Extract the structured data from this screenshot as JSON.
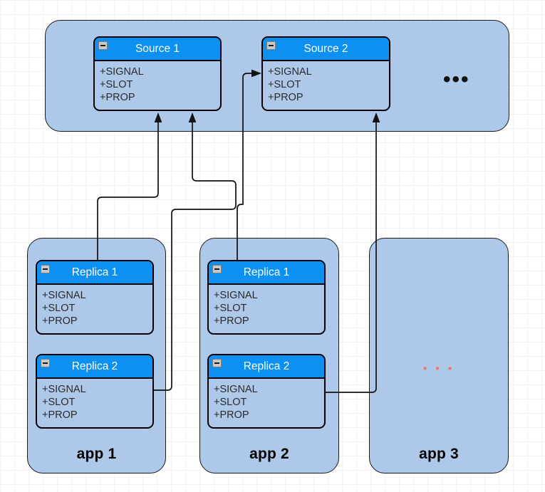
{
  "diagram": {
    "title": "Signal/Slot source and replica object diagram",
    "colors": {
      "group_fill": "#aec8ea",
      "node_title_bar": "#0c90f2",
      "node_title_text": "#ffffff",
      "node_body_fill": "#aec8ea",
      "node_border": "#000000",
      "connector": "#111111",
      "ellipsis_accent": "#f3705a",
      "grid_minor": "#f2f2f2",
      "grid_major": "#dadada",
      "canvas_background": "#ffffff"
    }
  },
  "members": [
    "+SIGNAL",
    "+SLOT",
    "+PROP"
  ],
  "icons": {
    "collapse": "collapse-minus-icon"
  },
  "source_group": {
    "name": "source-container",
    "ellipsis": "•••",
    "nodes": [
      {
        "title": "Source 1",
        "members": [
          "+SIGNAL",
          "+SLOT",
          "+PROP"
        ]
      },
      {
        "title": "Source 2",
        "members": [
          "+SIGNAL",
          "+SLOT",
          "+PROP"
        ]
      }
    ]
  },
  "apps": [
    {
      "label": "app 1",
      "nodes": [
        {
          "title": "Replica 1",
          "members": [
            "+SIGNAL",
            "+SLOT",
            "+PROP"
          ]
        },
        {
          "title": "Replica 2",
          "members": [
            "+SIGNAL",
            "+SLOT",
            "+PROP"
          ]
        }
      ],
      "ellipsis": ""
    },
    {
      "label": "app 2",
      "nodes": [
        {
          "title": "Replica 1",
          "members": [
            "+SIGNAL",
            "+SLOT",
            "+PROP"
          ]
        },
        {
          "title": "Replica 2",
          "members": [
            "+SIGNAL",
            "+SLOT",
            "+PROP"
          ]
        }
      ],
      "ellipsis": ""
    },
    {
      "label": "app 3",
      "nodes": [],
      "ellipsis": "▪ ▪ ▪"
    }
  ],
  "connections": [
    {
      "from": "app1.Replica 1",
      "to": "Source 1",
      "arrow": "up"
    },
    {
      "from": "app1.Replica 2",
      "to": "Source 1",
      "arrow": "up"
    },
    {
      "from": "app2.Replica 1",
      "to": "Source 2",
      "arrow": "left-in"
    },
    {
      "from": "app2.Replica 2",
      "to": "Source 2",
      "arrow": "up"
    }
  ]
}
